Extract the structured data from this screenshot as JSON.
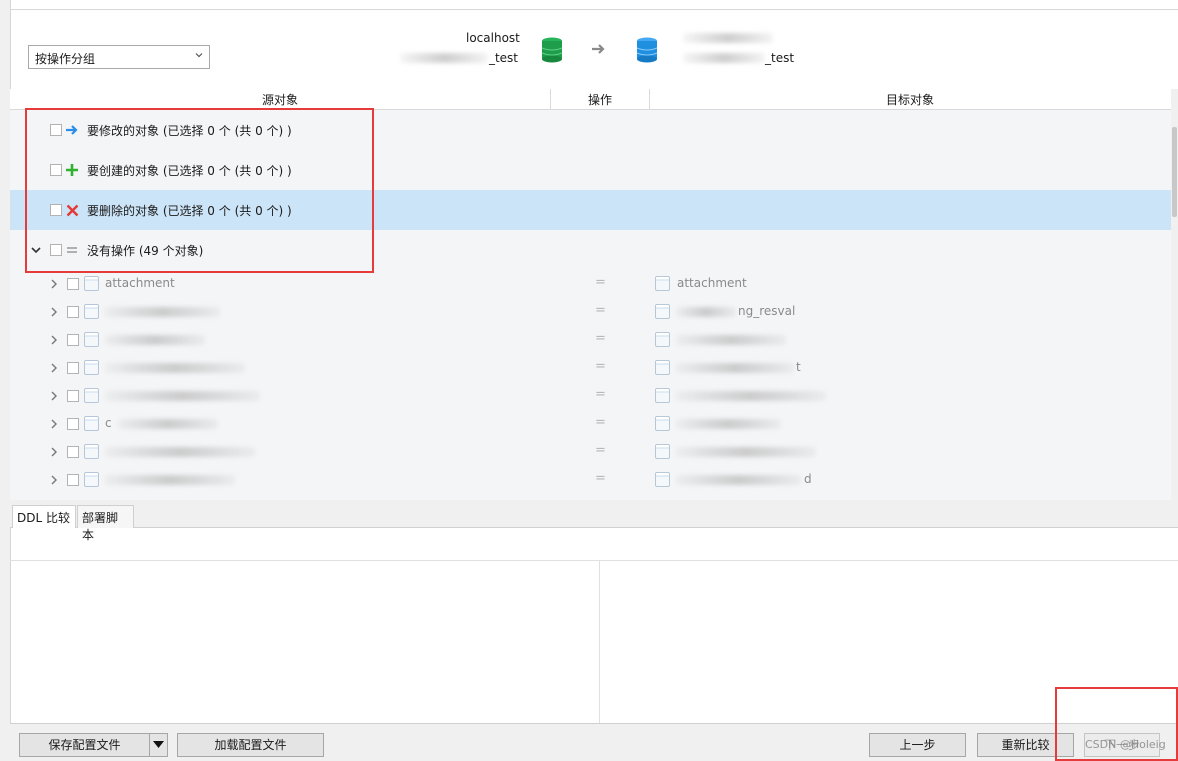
{
  "toolbar": {
    "group_by_value": "按操作分组"
  },
  "connection": {
    "source_host": "localhost",
    "source_db": "_test",
    "target_db": "_test"
  },
  "columns": {
    "source": "源对象",
    "operation": "操作",
    "target": "目标对象"
  },
  "groups": [
    {
      "label": "要修改的对象 (已选择 0 个 (共 0 个) )",
      "icon": "arrow-right-icon",
      "color": "#2b8ee8"
    },
    {
      "label": "要创建的对象 (已选择 0 个 (共 0 个) )",
      "icon": "plus-icon",
      "color": "#2fb32f"
    },
    {
      "label": "要删除的对象 (已选择 0 个 (共 0 个) )",
      "icon": "cross-icon",
      "color": "#e53935"
    },
    {
      "label": "没有操作 (49 个对象)",
      "icon": "equals-icon",
      "color": "#9a9a9a"
    }
  ],
  "items": [
    {
      "source": "attachment",
      "op": "=",
      "target": "attachment"
    },
    {
      "source": "",
      "op": "=",
      "target": "ng_resval"
    },
    {
      "source": "",
      "op": "=",
      "target": ""
    },
    {
      "source": "",
      "op": "=",
      "target": "t"
    },
    {
      "source": "",
      "op": "=",
      "target": ""
    },
    {
      "source": "c",
      "op": "=",
      "target": ""
    },
    {
      "source": "",
      "op": "=",
      "target": ""
    },
    {
      "source": "",
      "op": "=",
      "target": "d"
    }
  ],
  "tabs": {
    "ddl": "DDL 比较",
    "script": "部署脚本"
  },
  "buttons": {
    "save_config": "保存配置文件",
    "load_config": "加载配置文件",
    "prev": "上一步",
    "recompare": "重新比较",
    "next": "下一步",
    "watermark": "CSDN @Holeig"
  },
  "colors": {
    "accent_selected": "#cce4f7",
    "annotation_red": "#e63b3b",
    "source_db_green": "#1e9e4a",
    "target_db_blue": "#1f8fe0"
  }
}
